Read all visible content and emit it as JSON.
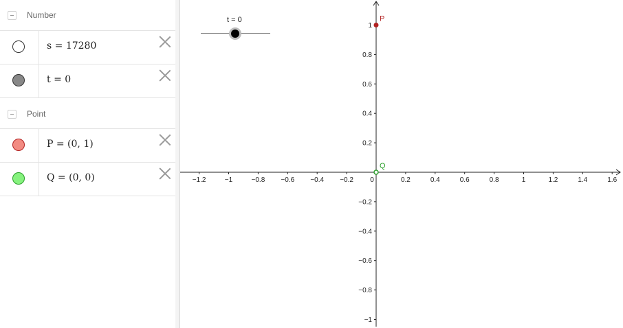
{
  "algebra": {
    "groups": [
      {
        "title": "Number",
        "items": [
          {
            "expression": "s = 17280",
            "marble_color": "#ffffff"
          },
          {
            "expression": "t = 0",
            "marble_color": "#888888"
          }
        ]
      },
      {
        "title": "Point",
        "items": [
          {
            "expression": "P = (0, 1)",
            "marble_color": "#f28b82"
          },
          {
            "expression": "Q = (0, 0)",
            "marble_color": "#86f27e"
          }
        ]
      }
    ]
  },
  "graphics": {
    "slider": {
      "label": "t = 0",
      "value": 0
    },
    "x_axis": {
      "ticks": [
        "−1.2",
        "−1",
        "−0.8",
        "−0.6",
        "−0.4",
        "−0.2",
        "0",
        "0.2",
        "0.4",
        "0.6",
        "0.8",
        "1",
        "1.2",
        "1.4",
        "1.6"
      ],
      "min": -1.2,
      "max": 1.6,
      "step": 0.2
    },
    "y_axis": {
      "ticks": [
        "1",
        "0.8",
        "0.6",
        "0.4",
        "0.2",
        "−0.2",
        "−0.4",
        "−0.6",
        "−0.8",
        "−1"
      ],
      "min": -1,
      "max": 1,
      "step": 0.2
    },
    "points": [
      {
        "name": "P",
        "x": 0,
        "y": 1,
        "color": "#b22222"
      },
      {
        "name": "Q",
        "x": 0,
        "y": 0,
        "color": "#2ca02c"
      }
    ]
  }
}
